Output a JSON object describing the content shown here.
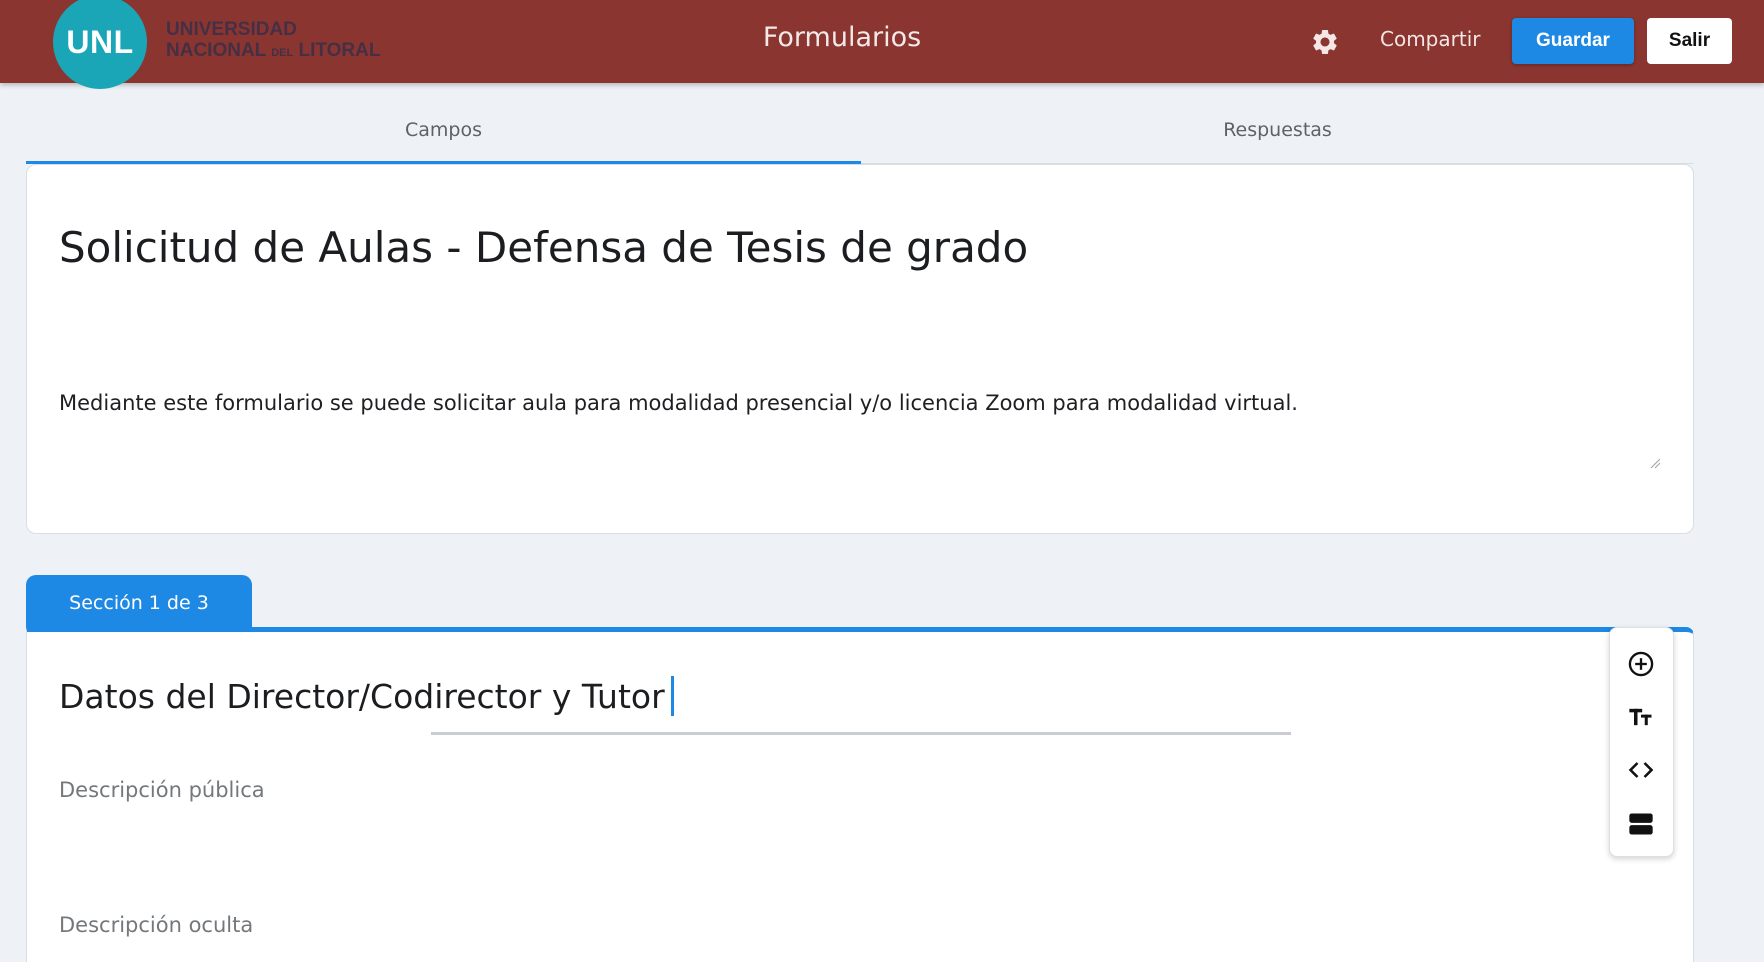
{
  "header": {
    "logo_abbr": "UNL",
    "logo_line1": "UNIVERSIDAD",
    "logo_line2_a": "NACIONAL",
    "logo_line2_b": "DEL",
    "logo_line2_c": "LITORAL",
    "app_title": "Formularios",
    "settings_icon": "gear-icon",
    "share_label": "Compartir",
    "save_label": "Guardar",
    "exit_label": "Salir"
  },
  "tabs": [
    {
      "label": "Campos",
      "active": true
    },
    {
      "label": "Respuestas",
      "active": false
    }
  ],
  "form": {
    "title": "Solicitud de Aulas - Defensa de Tesis de grado",
    "description": "Mediante este formulario se puede solicitar aula para modalidad presencial y/o licencia Zoom para modalidad virtual."
  },
  "section": {
    "tab_label": "Sección 1 de 3",
    "title": "Datos del Director/Codirector y Tutor",
    "public_description_placeholder": "Descripción pública",
    "hidden_description_placeholder": "Descripción oculta"
  },
  "toolbar": {
    "items": [
      "add-field-icon",
      "text-size-icon",
      "code-icon",
      "section-icon"
    ]
  },
  "colors": {
    "header_bg": "#8a3530",
    "accent": "#1e88e5",
    "logo_teal": "#1ba6b8",
    "page_bg": "#eef2f6"
  }
}
